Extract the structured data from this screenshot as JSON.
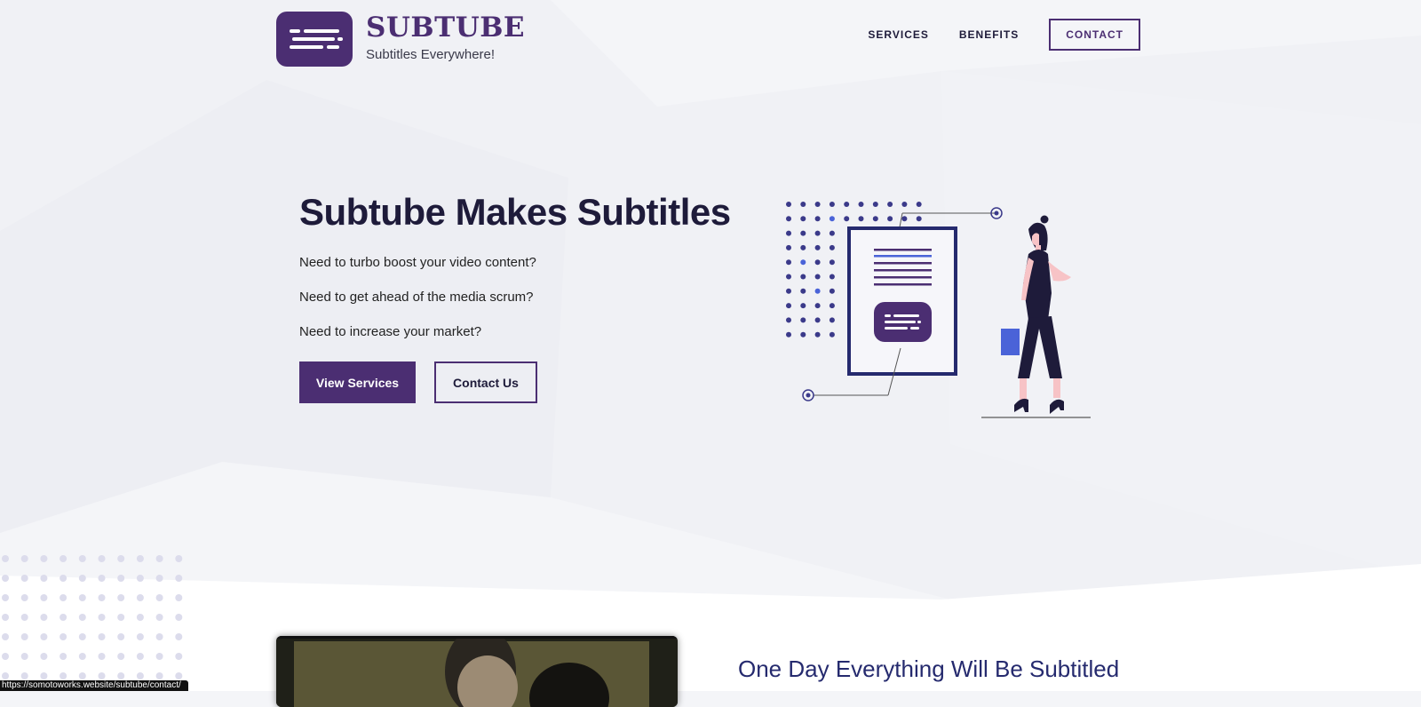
{
  "brand": {
    "name": "SUBTUBE",
    "tagline": "Subtitles Everywhere!",
    "color": "#4b2e72"
  },
  "nav": {
    "items": [
      {
        "label": "SERVICES"
      },
      {
        "label": "BENEFITS"
      }
    ],
    "contact_label": "CONTACT"
  },
  "hero": {
    "title": "Subtube Makes Subtitles",
    "lines": [
      "Need to turbo boost your video content?",
      "Need to get ahead of the media scrum?",
      "Need to increase your market?"
    ],
    "primary_button": "View Services",
    "secondary_button": "Contact Us"
  },
  "section": {
    "title": "One Day Everything Will Be Subtitled"
  },
  "status_bar": {
    "url": "https://somotoworks.website/subtube/contact/"
  },
  "colors": {
    "accent": "#4b2e72",
    "navy": "#252a6e",
    "dot": "#3b3a8a",
    "highlight_blue": "#4a63d8",
    "background": "#f4f5f8"
  },
  "icons": [
    "logo-subtitle-icon",
    "woman-illustration",
    "document-illustration"
  ]
}
